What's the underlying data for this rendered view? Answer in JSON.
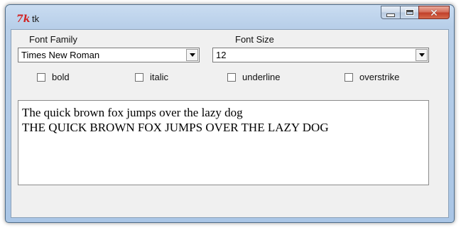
{
  "window": {
    "title": "tk",
    "icon": "tk-feather-icon",
    "controls": {
      "minimize": "minimize-icon",
      "maximize": "maximize-icon",
      "close": "close-icon"
    }
  },
  "font_family": {
    "label": "Font Family",
    "selected": "Times New Roman"
  },
  "font_size": {
    "label": "Font Size",
    "selected": "12"
  },
  "options": [
    {
      "label": "bold",
      "checked": false
    },
    {
      "label": "italic",
      "checked": false
    },
    {
      "label": "underline",
      "checked": false
    },
    {
      "label": "overstrike",
      "checked": false
    }
  ],
  "preview": {
    "line1": "The quick brown fox jumps over the lazy dog",
    "line2": "THE QUICK BROWN FOX JUMPS OVER THE LAZY DOG"
  },
  "colors": {
    "titlebar": "#b8cfe9",
    "close_button": "#c1402a",
    "client_bg": "#f0f0f0"
  }
}
